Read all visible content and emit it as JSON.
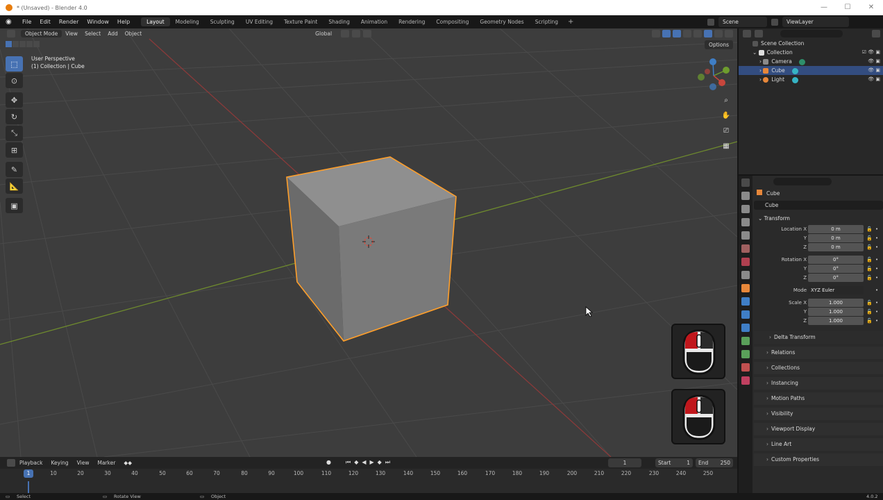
{
  "window": {
    "title": "* (Unsaved) - Blender 4.0",
    "controls": [
      "—",
      "☐",
      "✕"
    ]
  },
  "menubar": {
    "menus": [
      "File",
      "Edit",
      "Render",
      "Window",
      "Help"
    ],
    "workspaces": [
      "Layout",
      "Modeling",
      "Sculpting",
      "UV Editing",
      "Texture Paint",
      "Shading",
      "Animation",
      "Rendering",
      "Compositing",
      "Geometry Nodes",
      "Scripting"
    ],
    "active_workspace": "Layout",
    "scene": "Scene",
    "view_layer": "ViewLayer"
  },
  "viewport": {
    "mode": "Object Mode",
    "menus": [
      "View",
      "Select",
      "Add",
      "Object"
    ],
    "transform_orientation": "Global",
    "options_label": "Options",
    "info_line1": "User Perspective",
    "info_line2": "(1) Collection | Cube"
  },
  "outliner": {
    "root": "Scene Collection",
    "collection": "Collection",
    "items": [
      {
        "label": "Camera",
        "icon": "camera-icon",
        "color": "#8a8a8a",
        "data_color": "#2e8f6b",
        "selected": false
      },
      {
        "label": "Cube",
        "icon": "mesh-icon",
        "color": "#e7873a",
        "data_color": "#36b3c4",
        "selected": true
      },
      {
        "label": "Light",
        "icon": "light-icon",
        "color": "#e7873a",
        "data_color": "#36b3c4",
        "selected": false
      }
    ]
  },
  "properties": {
    "object_name": "Cube",
    "object_field": "Cube",
    "transform_title": "Transform",
    "location": {
      "label": "Location X",
      "x": "0 m",
      "y": "0 m",
      "z": "0 m"
    },
    "rotation": {
      "label": "Rotation X",
      "x": "0°",
      "y": "0°",
      "z": "0°"
    },
    "mode_label": "Mode",
    "mode_value": "XYZ Euler",
    "scale": {
      "label": "Scale X",
      "x": "1.000",
      "y": "1.000",
      "z": "1.000"
    },
    "axis_y": "Y",
    "axis_z": "Z",
    "delta_transform": "Delta Transform",
    "panels": [
      "Relations",
      "Collections",
      "Instancing",
      "Motion Paths",
      "Visibility",
      "Viewport Display",
      "Line Art",
      "Custom Properties"
    ]
  },
  "timeline": {
    "menus": [
      "Playback",
      "Keying",
      "View",
      "Marker"
    ],
    "current_frame": "1",
    "start_label": "Start",
    "start_value": "1",
    "end_label": "End",
    "end_value": "250",
    "ticks": [
      "10",
      "20",
      "30",
      "40",
      "50",
      "60",
      "70",
      "80",
      "90",
      "100",
      "110",
      "120",
      "130",
      "140",
      "150",
      "160",
      "170",
      "180",
      "190",
      "200",
      "210",
      "220",
      "230",
      "240",
      "250"
    ],
    "cursor_frame": "1"
  },
  "statusbar": {
    "items": [
      "Select",
      "Rotate View",
      "Object"
    ],
    "version": "4.0.2"
  },
  "colors": {
    "accent": "#4772b3",
    "selection_outline": "#ff9f2a",
    "x_axis": "#8a3a3a",
    "y_axis": "#6e8a2e"
  }
}
